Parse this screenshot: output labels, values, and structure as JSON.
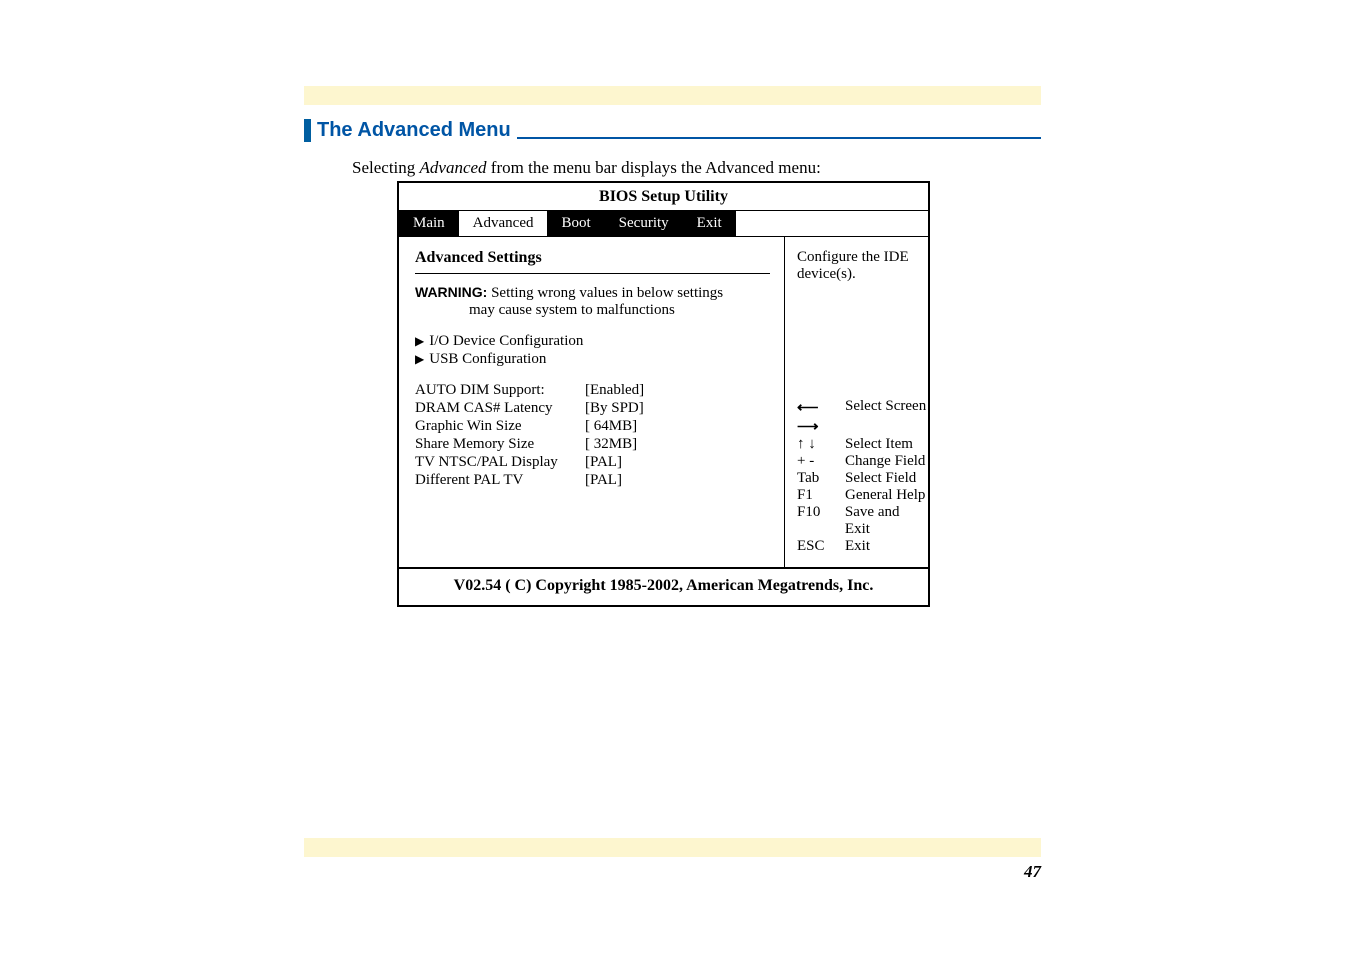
{
  "heading": "The Advanced Menu",
  "intro_prefix": "Selecting ",
  "intro_em": "Advanced",
  "intro_suffix": " from the menu bar displays the Advanced menu:",
  "bios": {
    "title": "BIOS Setup Utility",
    "tabs": [
      "Main",
      "Advanced",
      "Boot",
      "Security",
      "Exit"
    ],
    "section_title": "Advanced Settings",
    "warning_label": "WARNING:",
    "warning_line1": " Setting wrong values in below settings",
    "warning_line2": "may cause system to malfunctions",
    "sub1": "I/O Device Configuration",
    "sub2": "USB Configuration",
    "rows": [
      {
        "label": "AUTO DIM Support:",
        "value": "[Enabled]"
      },
      {
        "label": "DRAM CAS# Latency",
        "value": "[By SPD]"
      },
      {
        "label": "Graphic Win Size",
        "value": "[  64MB]"
      },
      {
        "label": "Share Memory Size",
        "value": "[  32MB]"
      },
      {
        "label": "TV NTSC/PAL Display",
        "value": "[PAL]"
      },
      {
        "label": "Different PAL TV",
        "value": "[PAL]"
      }
    ],
    "help_title1": "Configure the IDE",
    "help_title2": "device(s).",
    "keys": [
      {
        "k": "⟵ ⟶",
        "d": "Select Screen"
      },
      {
        "k": "↑ ↓",
        "d": "Select Item"
      },
      {
        "k": "+ -",
        "d": "Change Field"
      },
      {
        "k": "Tab",
        "d": "Select Field"
      },
      {
        "k": "F1",
        "d": "General Help"
      },
      {
        "k": "F10",
        "d": "Save and Exit"
      },
      {
        "k": "ESC",
        "d": "Exit"
      }
    ],
    "copyright": "V02.54  ( C) Copyright 1985-2002, American Megatrends, Inc."
  },
  "page_number": "47"
}
